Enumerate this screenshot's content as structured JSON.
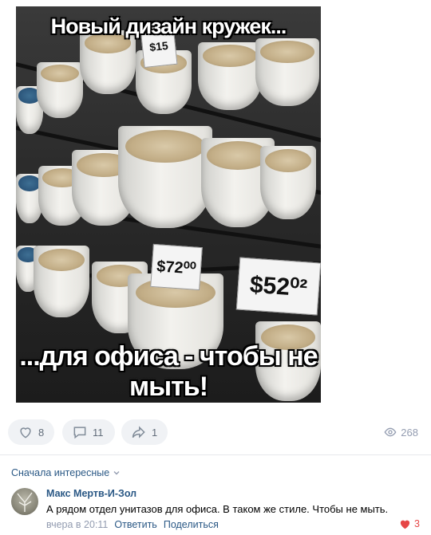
{
  "post": {
    "image": {
      "caption_top": "Новый дизайн кружек...",
      "caption_bottom_line1": "...для офиса - чтобы не",
      "caption_bottom_line2": "мыть!",
      "price_tag_1": "$52⁰²",
      "price_tag_2": "$72⁰⁰",
      "price_tag_3": "$15"
    },
    "actions": {
      "likes": "8",
      "comments": "11",
      "shares": "1",
      "views": "268"
    }
  },
  "comments": {
    "sort_label": "Сначала интересные",
    "items": [
      {
        "author": "Макс Мертв-И-Зол",
        "text": "А рядом отдел унитазов для офиса. В таком же стиле. Чтобы не мыть.",
        "time": "вчера в 20:11",
        "reply_label": "Ответить",
        "share_label": "Поделиться",
        "likes": "3"
      }
    ]
  },
  "colors": {
    "link": "#2a5885",
    "muted": "#939cb0",
    "like_active": "#e64646",
    "pill_bg": "#f0f2f5"
  },
  "icons": [
    "heart-icon",
    "comment-icon",
    "share-icon",
    "eye-icon",
    "chevron-down-icon",
    "heart-filled-icon"
  ]
}
